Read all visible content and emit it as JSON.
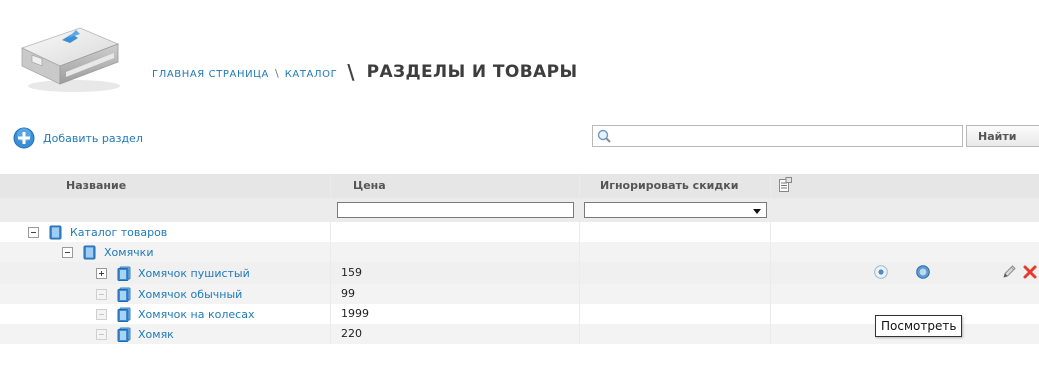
{
  "breadcrumb": {
    "home": "ГЛАВНАЯ СТРАНИЦА",
    "separator": "\\",
    "catalog": "КАТАЛОГ",
    "title_separator": "\\",
    "title": "РАЗДЕЛЫ И ТОВАРЫ"
  },
  "toolbar": {
    "add_section_label": "Добавить раздел",
    "search_value": "",
    "search_placeholder": "",
    "find_button_label": "Найти"
  },
  "table": {
    "columns": {
      "name": "Название",
      "price": "Цена",
      "ignore_discounts": "Игнорировать скидки"
    },
    "filters": {
      "price_value": "",
      "ignore_discounts_selected": ""
    },
    "rows": [
      {
        "name": "Каталог товаров",
        "price": ""
      },
      {
        "name": "Хомячки",
        "price": ""
      },
      {
        "name": "Хомячок пушистый",
        "price": "159"
      },
      {
        "name": "Хомячок обычный",
        "price": "99"
      },
      {
        "name": "Хомячок на колесах",
        "price": "1999"
      },
      {
        "name": "Хомяк",
        "price": "220"
      }
    ]
  },
  "tooltip": {
    "text": "Посмотреть"
  },
  "icons": {
    "logo": "catalog-box-logo",
    "add": "plus-circle-icon",
    "search": "magnifier-icon",
    "column_settings": "column-settings-icon",
    "folder": "folder-icon",
    "product": "product-icon",
    "view": "eye-icon",
    "activate": "circle-icon",
    "edit": "pencil-icon",
    "delete": "x-icon"
  },
  "colors": {
    "link": "#1f7ab8",
    "delete": "#e53b2c",
    "header_bg": "#e6e6e6"
  }
}
